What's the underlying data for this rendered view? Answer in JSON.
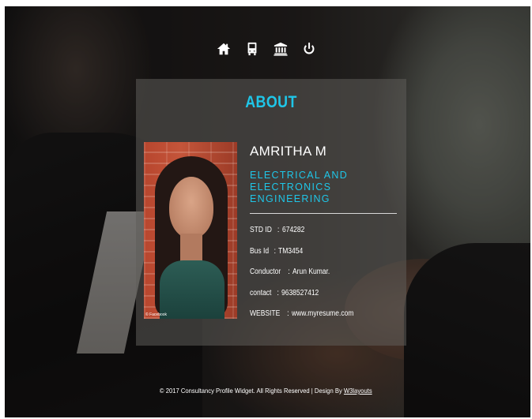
{
  "nav": {
    "items": [
      {
        "icon": "home-icon"
      },
      {
        "icon": "bus-icon"
      },
      {
        "icon": "bank-icon"
      },
      {
        "icon": "power-icon"
      }
    ]
  },
  "about": {
    "title": "ABOUT",
    "name": "AMRITHA M",
    "department_line1": "ELECTRICAL AND",
    "department_line2": "ELECTRONICS ENGINEERING",
    "photo_caption": "© Facebook",
    "details": [
      {
        "label": "STD ID",
        "value": "674282"
      },
      {
        "label": "Bus Id",
        "value": "TM3454"
      },
      {
        "label": "Conductor",
        "value": "Arun Kumar."
      },
      {
        "label": "contact",
        "value": "9638527412"
      },
      {
        "label": "WEBSITE",
        "value": "www.myresume.com"
      }
    ]
  },
  "footer": {
    "text": "© 2017 Consultancy Profile Widget. All Rights Reserved | Design By",
    "link": "W3layouts"
  },
  "colors": {
    "accent": "#1fc6e8",
    "text": "#ffffff"
  }
}
